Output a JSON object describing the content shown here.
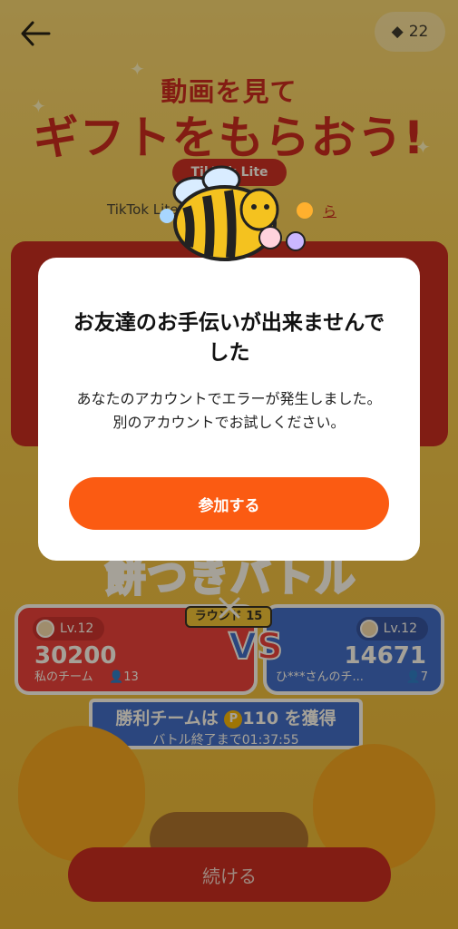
{
  "header": {
    "ticket_count": "22"
  },
  "promo": {
    "headline_small": "動画を見て",
    "headline_large": "ギフトをもらおう!",
    "logo_text": "TikTok Lite",
    "tiktok_line": "TikTok Lite",
    "tiktok_link": "ら"
  },
  "battle": {
    "title": "餅つきバトル",
    "round": "ラウンド 15",
    "red_team": {
      "level": "Lv.12",
      "score": "30200",
      "name": "私のチーム",
      "members": "13"
    },
    "blue_team": {
      "level": "Lv.12",
      "score": "14671",
      "name": "ひ***さんのチ...",
      "members": "7"
    },
    "vs": "VS",
    "banner_title_prefix": "勝利チームは",
    "banner_points": "110",
    "banner_title_suffix": "を獲得",
    "banner_sub": "バトル終了まで01:37:55",
    "continue_label": "続ける"
  },
  "modal": {
    "title": "お友達のお手伝いが出来ませんでした",
    "body": "あなたのアカウントでエラーが発生しました。別のアカウントでお試しください。",
    "button_label": "参加する"
  },
  "colors": {
    "accent_red": "#c41a1a",
    "accent_orange": "#fb5b12",
    "team_blue": "#2e63d2"
  }
}
